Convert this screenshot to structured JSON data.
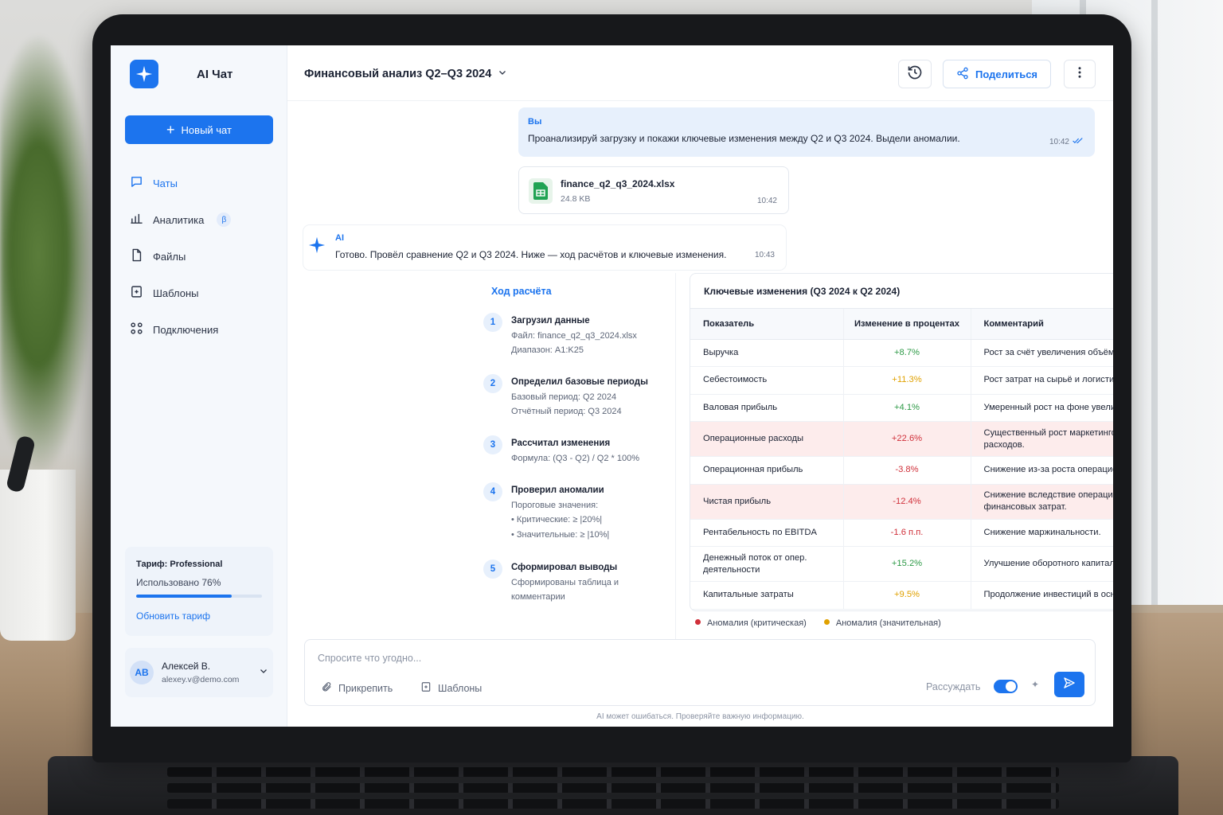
{
  "app": {
    "title": "AI Чат",
    "new_chat": "Новый чат"
  },
  "nav": [
    {
      "label": "Чаты",
      "icon": "chat-icon",
      "active": true
    },
    {
      "label": "Аналитика",
      "icon": "analytics-icon",
      "badge": "β"
    },
    {
      "label": "Файлы",
      "icon": "file-icon"
    },
    {
      "label": "Шаблоны",
      "icon": "template-icon"
    },
    {
      "label": "Подключения",
      "icon": "connections-icon"
    }
  ],
  "plan": {
    "label": "Тариф: Professional",
    "usage_text": "Использовано 76%",
    "usage_fraction": 0.76,
    "upgrade": "Обновить тариф"
  },
  "user": {
    "initials": "AB",
    "name": "Алексей В.",
    "email": "alexey.v@demo.com"
  },
  "header": {
    "title": "Финансовый анализ Q2–Q3 2024",
    "share": "Поделиться"
  },
  "messages": {
    "user": {
      "author": "Вы",
      "text": "Проанализируй загрузку и покажи ключевые изменения между Q2 и Q3 2024. Выдели аномалии.",
      "time": "10:42"
    },
    "file": {
      "name": "finance_q2_q3_2024.xlsx",
      "size": "24.8 KB",
      "time": "10:42"
    },
    "ai": {
      "author": "AI",
      "text": "Готово. Провёл сравнение Q2 и Q3 2024. Ниже — ход расчётов и ключевые изменения.",
      "time": "10:43"
    }
  },
  "steps": {
    "title": "Ход расчёта",
    "items": [
      {
        "num": "1",
        "title": "Загрузил данные",
        "lines": [
          "Файл: finance_q2_q3_2024.xlsx",
          "Диапазон: A1:K25"
        ]
      },
      {
        "num": "2",
        "title": "Определил базовые периоды",
        "lines": [
          "Базовый период: Q2 2024",
          "Отчётный период: Q3 2024"
        ]
      },
      {
        "num": "3",
        "title": "Рассчитал изменения",
        "lines": [
          "Формула: (Q3 - Q2) / Q2 * 100%"
        ]
      },
      {
        "num": "4",
        "title": "Проверил аномалии",
        "lines": [
          "Пороговые значения:",
          "•  Критические: ≥ |20%|",
          "•  Значительные: ≥ |10%|"
        ]
      },
      {
        "num": "5",
        "title": "Сформировал выводы",
        "lines": [
          "Сформированы таблица и",
          "комментарии"
        ]
      }
    ]
  },
  "table": {
    "title": "Ключевые изменения (Q3 2024 к Q2 2024)",
    "headers": [
      "Показатель",
      "Изменение в процентах",
      "Комментарий"
    ],
    "rows": [
      {
        "name": "Выручка",
        "change": "+8.7%",
        "tone": "pos",
        "comment": "Рост за счёт увеличения объёма продаж в ключевых сегментах."
      },
      {
        "name": "Себестоимость",
        "change": "+11.3%",
        "tone": "warn",
        "comment": "Рост затрат на сырьё и логистику."
      },
      {
        "name": "Валовая прибыль",
        "change": "+4.1%",
        "tone": "pos",
        "comment": "Умеренный рост на фоне увеличения выручки."
      },
      {
        "name": "Операционные расходы",
        "change": "+22.6%",
        "tone": "neg",
        "critical": true,
        "comment": "Существенный рост маркетинговых и административных расходов."
      },
      {
        "name": "Операционная прибыль",
        "change": "-3.8%",
        "tone": "neg",
        "comment": "Снижение из-за роста операционных расходов."
      },
      {
        "name": "Чистая прибыль",
        "change": "-12.4%",
        "tone": "neg",
        "critical": true,
        "comment": "Снижение вследствие операционных расходов и финансовых затрат."
      },
      {
        "name": "Рентабельность по EBITDA",
        "change": "-1.6 п.п.",
        "tone": "neg",
        "comment": "Снижение маржинальности."
      },
      {
        "name": "Денежный поток от опер. деятельности",
        "change": "+15.2%",
        "tone": "pos",
        "comment": "Улучшение оборотного капитала."
      },
      {
        "name": "Капитальные затраты",
        "change": "+9.5%",
        "tone": "warn",
        "comment": "Продолжение инвестиций в основное производство."
      }
    ]
  },
  "legend": [
    {
      "label": "Аномалия (критическая)",
      "color": "#d0303a"
    },
    {
      "label": "Аномалия (значительная)",
      "color": "#e0a100"
    }
  ],
  "composer": {
    "placeholder": "Спросите что угодно...",
    "attach": "Прикрепить",
    "templates": "Шаблоны",
    "reason": "Рассуждать",
    "reason_enabled": true
  },
  "disclaimer": "AI может ошибаться. Проверяйте важную информацию."
}
